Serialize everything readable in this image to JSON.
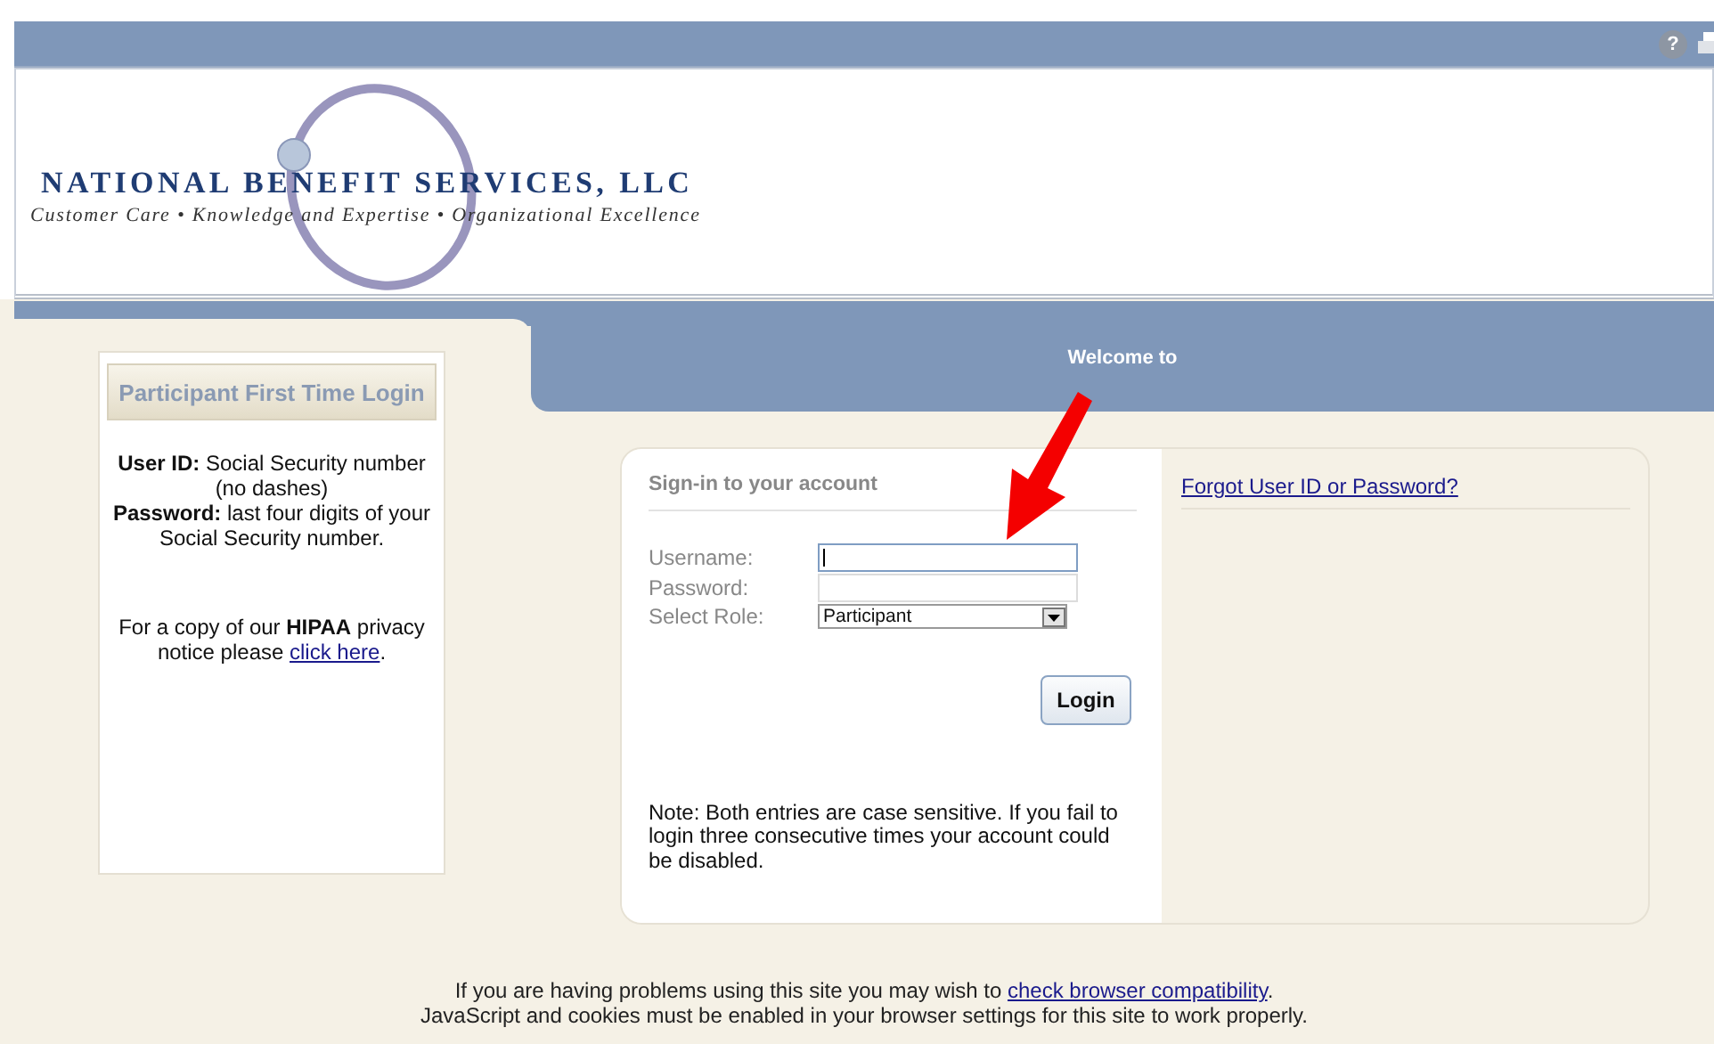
{
  "toolbar": {
    "help_icon": "?"
  },
  "logo": {
    "company": "NATIONAL BENEFIT SERVICES, LLC",
    "tagline": "Customer Care • Knowledge and Expertise • Organizational Excellence"
  },
  "banner": {
    "title": "Welcome to"
  },
  "first_time_login": {
    "title": "Participant First Time Login",
    "instructions": [
      "**User ID:** Social Security number (no dashes)",
      "**Password:** last four digits of your Social Security number."
    ],
    "privacy_notice": {
      "text": "For a copy of our **HIPAA** privacy notice please",
      "link": "click here",
      "text_after": "."
    }
  },
  "sign_in": {
    "title": "Sign-in to your account",
    "fields": [
      {
        "label": "Username:",
        "kind": "text",
        "focused": true
      },
      {
        "label": "Password:",
        "kind": "password",
        "focused": false
      },
      {
        "label": "Select Role:",
        "kind": "select",
        "value": "Participant"
      }
    ],
    "button": "Login",
    "note": "Note: Both entries are case sensitive. If you fail to login three consecutive times your account could be disabled."
  },
  "help": {
    "link": "Forgot User ID or Password?"
  },
  "footer": {
    "text": "If you are having problems using this site you may wish to",
    "link": "check browser compatibility",
    "text_after": ".",
    "note": "JavaScript and cookies must be enabled in your browser settings for this site to work properly."
  }
}
